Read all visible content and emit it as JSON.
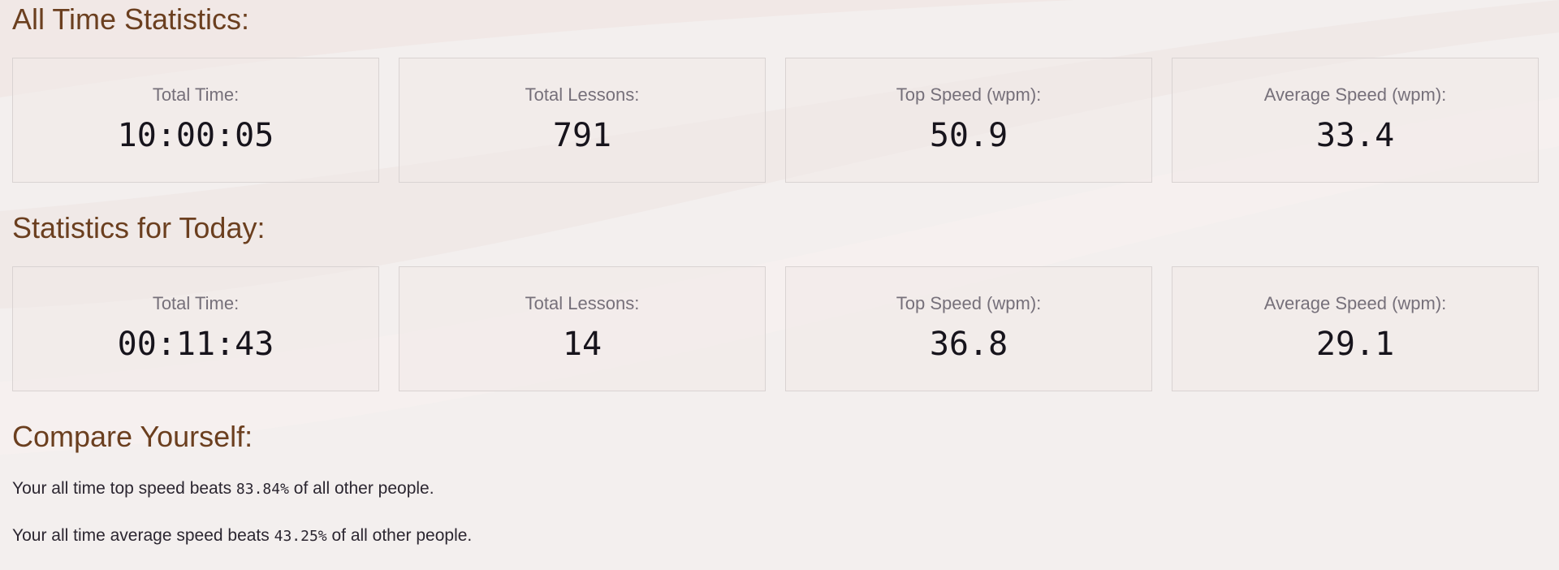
{
  "all_time": {
    "title": "All Time Statistics:",
    "cards": [
      {
        "label": "Total Time:",
        "value": "10:00:05"
      },
      {
        "label": "Total Lessons:",
        "value": "791"
      },
      {
        "label": "Top Speed (wpm):",
        "value": "50.9"
      },
      {
        "label": "Average Speed (wpm):",
        "value": "33.4"
      }
    ]
  },
  "today": {
    "title": "Statistics for Today:",
    "cards": [
      {
        "label": "Total Time:",
        "value": "00:11:43"
      },
      {
        "label": "Total Lessons:",
        "value": "14"
      },
      {
        "label": "Top Speed (wpm):",
        "value": "36.8"
      },
      {
        "label": "Average Speed (wpm):",
        "value": "29.1"
      }
    ]
  },
  "compare": {
    "title": "Compare Yourself:",
    "top_speed": {
      "prefix": "Your all time top speed beats ",
      "percent": "83.84%",
      "suffix": " of all other people."
    },
    "avg_speed": {
      "prefix": "Your all time average speed beats ",
      "percent": "43.25%",
      "suffix": " of all other people."
    }
  },
  "colors": {
    "heading": "#6b3f1f",
    "background": "#f3efee",
    "card_border": "#d9d3d2",
    "label": "#76707a",
    "value": "#17141c"
  }
}
